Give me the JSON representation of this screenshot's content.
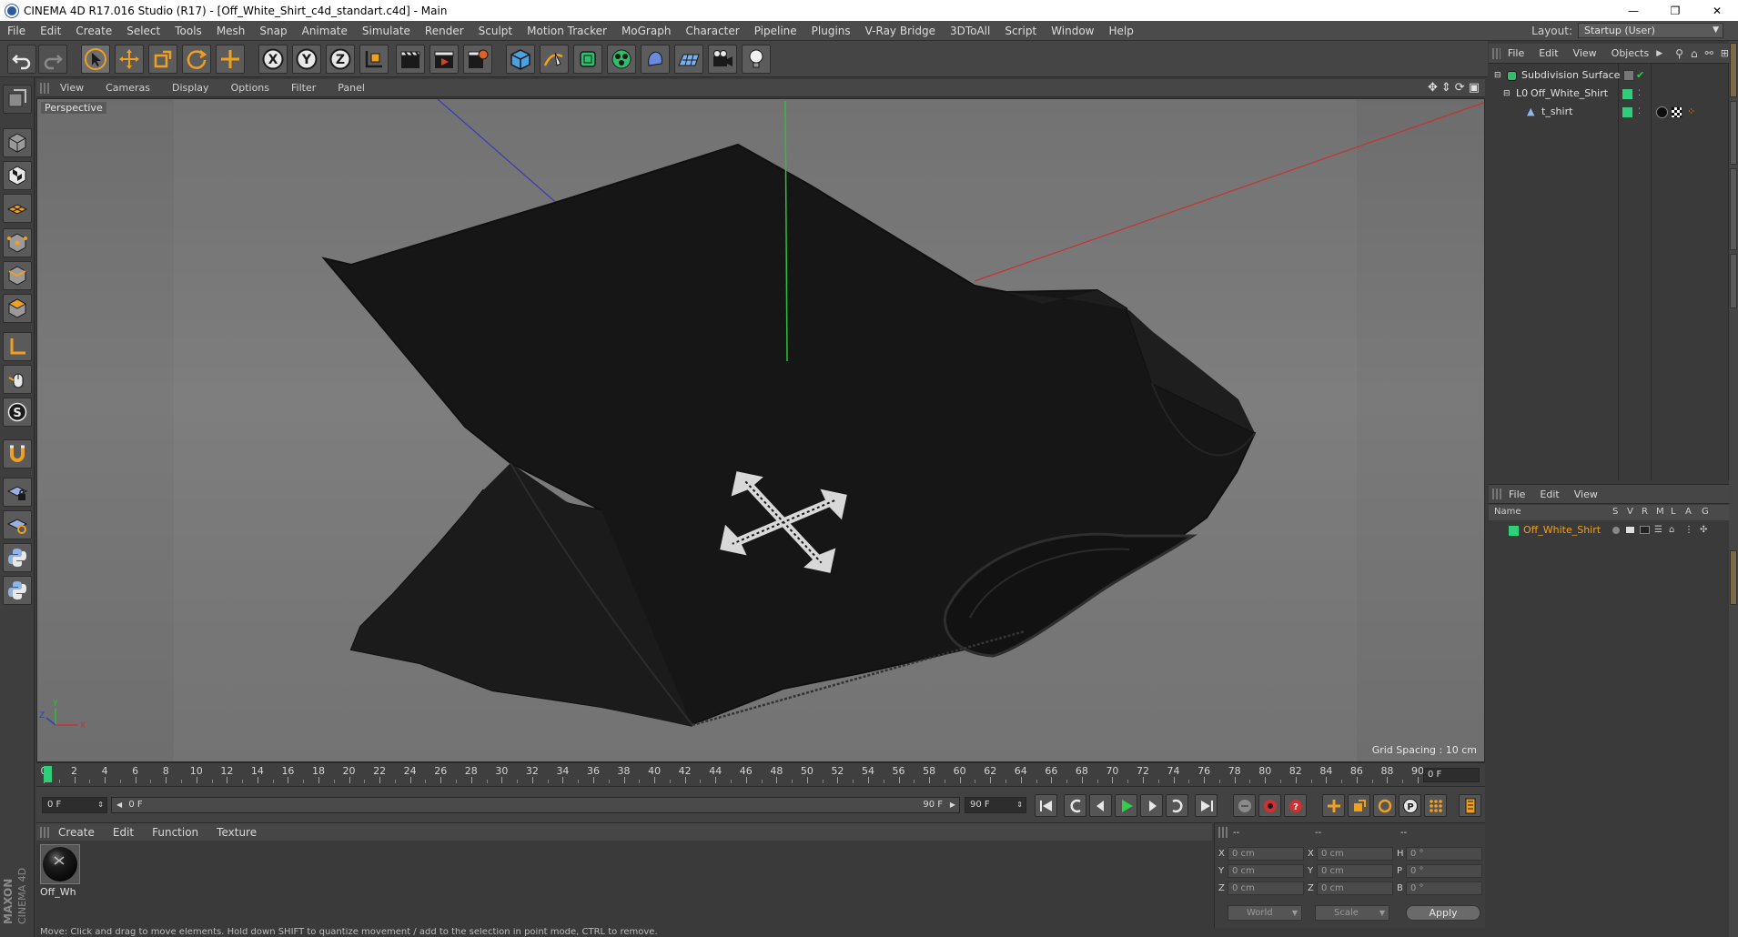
{
  "window": {
    "title": "CINEMA 4D R17.016 Studio (R17) - [Off_White_Shirt_c4d_standart.c4d] - Main",
    "minimize": "—",
    "restore": "❐",
    "close": "✕"
  },
  "menu": {
    "items": [
      "File",
      "Edit",
      "Create",
      "Select",
      "Tools",
      "Mesh",
      "Snap",
      "Animate",
      "Simulate",
      "Render",
      "Sculpt",
      "Motion Tracker",
      "MoGraph",
      "Character",
      "Pipeline",
      "Plugins",
      "V-Ray Bridge",
      "3DToAll",
      "Script",
      "Window",
      "Help"
    ],
    "layout_label": "Layout:",
    "layout_value": "Startup (User)"
  },
  "viewport": {
    "menu": [
      "View",
      "Cameras",
      "Display",
      "Options",
      "Filter",
      "Panel"
    ],
    "label": "Perspective",
    "grid_spacing": "Grid Spacing : 10 cm",
    "axis_x": "X",
    "axis_y": "Y",
    "axis_z": "Z"
  },
  "timeline": {
    "ticks": [
      "0",
      "2",
      "4",
      "6",
      "8",
      "10",
      "12",
      "14",
      "16",
      "18",
      "20",
      "22",
      "24",
      "26",
      "28",
      "30",
      "32",
      "34",
      "36",
      "38",
      "40",
      "42",
      "44",
      "46",
      "48",
      "50",
      "52",
      "54",
      "56",
      "58",
      "60",
      "62",
      "64",
      "66",
      "68",
      "70",
      "72",
      "74",
      "76",
      "78",
      "80",
      "82",
      "84",
      "86",
      "88",
      "90"
    ],
    "current_frame": "0 F"
  },
  "transport": {
    "start_field": "0 F",
    "range_start": "0 F",
    "range_end": "90 F",
    "end_field": "90 F"
  },
  "material_manager": {
    "menu": [
      "Create",
      "Edit",
      "Function",
      "Texture"
    ],
    "material_name": "Off_Wh"
  },
  "coordinates": {
    "header_a": "--",
    "header_b": "--",
    "header_c": "--",
    "rows": [
      {
        "l1": "X",
        "v1": "0 cm",
        "l2": "X",
        "v2": "0 cm",
        "l3": "H",
        "v3": "0 °"
      },
      {
        "l1": "Y",
        "v1": "0 cm",
        "l2": "Y",
        "v2": "0 cm",
        "l3": "P",
        "v3": "0 °"
      },
      {
        "l1": "Z",
        "v1": "0 cm",
        "l2": "Z",
        "v2": "0 cm",
        "l3": "B",
        "v3": "0 °"
      }
    ],
    "space": "World",
    "mode": "Scale",
    "apply": "Apply"
  },
  "object_manager": {
    "menu": [
      "File",
      "Edit",
      "View",
      "Objects"
    ],
    "objects": [
      {
        "name": "Subdivision Surface",
        "indent": 0
      },
      {
        "name": "Off_White_Shirt",
        "indent": 1
      },
      {
        "name": "t_shirt",
        "indent": 2
      }
    ]
  },
  "attribute_manager": {
    "menu": [
      "File",
      "Edit",
      "View"
    ],
    "columns": [
      "Name",
      "S",
      "V",
      "R",
      "M",
      "L",
      "A",
      "G"
    ],
    "layer_name": "Off_White_Shirt"
  },
  "status": {
    "text": "Move: Click and drag to move elements. Hold down SHIFT to quantize movement / add to the selection in point mode, CTRL to remove."
  },
  "brand": {
    "maxon": "MAXON",
    "cinema": "CINEMA 4D"
  },
  "colors": {
    "accent_orange": "#f0a020",
    "layer_green": "#2fcf7a",
    "shirt": "#161616",
    "axis_x": "#c83232",
    "axis_y": "#2fbf3a",
    "axis_z": "#3c3cb4"
  }
}
